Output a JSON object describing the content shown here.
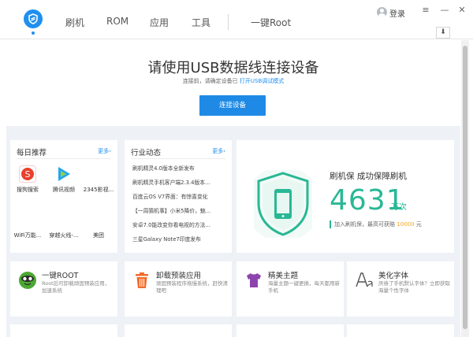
{
  "nav": {
    "items": [
      "刷机",
      "ROM",
      "应用",
      "工具"
    ],
    "root": "一键Root"
  },
  "titlebar": {
    "login": "登录",
    "menu_glyph": "≡",
    "minimize_glyph": "—",
    "close_glyph": "✕",
    "download_glyph": "⬇"
  },
  "hero": {
    "title": "请使用USB数据线连接设备",
    "subtitle": "连接前，请确定设备已",
    "subtitle_link": "打开USB调试模式",
    "connect_button": "连接设备"
  },
  "daily": {
    "title": "每日推荐",
    "more": "更多›",
    "apps": [
      {
        "label": "搜狗搜索",
        "color": "#e8402e"
      },
      {
        "label": "腾讯视频",
        "color": "#24a6f1"
      },
      {
        "label": "2345影视..."
      },
      {
        "label": "WiFi万能..."
      },
      {
        "label": "穿越火线-..."
      },
      {
        "label": "美团"
      }
    ]
  },
  "news": {
    "title": "行业动态",
    "more": "更多›",
    "items": [
      "刷机精灵4.0版本全新发布",
      "刷机精灵手机客户端2.3.4版本...",
      "百度云OS V7界面：有惊喜变化",
      "【一周猜机事】小米5降价，魅...",
      "安卓7.0能改变你看电视的方法...",
      "三星Galaxy Note7印度发布"
    ]
  },
  "protect": {
    "title": "刷机保  成功保障刷机",
    "count": "4631",
    "unit": "万次",
    "note_prefix": "加入刷机保，最高可获赔",
    "note_amount": "10000",
    "note_suffix": "元",
    "color": "#28b895"
  },
  "features": [
    {
      "title": "一键ROOT",
      "desc": "Root后可卸载顽固预装应用，加速系统"
    },
    {
      "title": "卸载预装应用",
      "desc": "顽固预装程序拖慢系统，赶快清理吧"
    },
    {
      "title": "精美主题",
      "desc": "海量主题一键更换，每天都用新手机"
    },
    {
      "title": "美化字体",
      "desc": "厌倦了手机默认字体？立即获取海量个性字体"
    }
  ]
}
